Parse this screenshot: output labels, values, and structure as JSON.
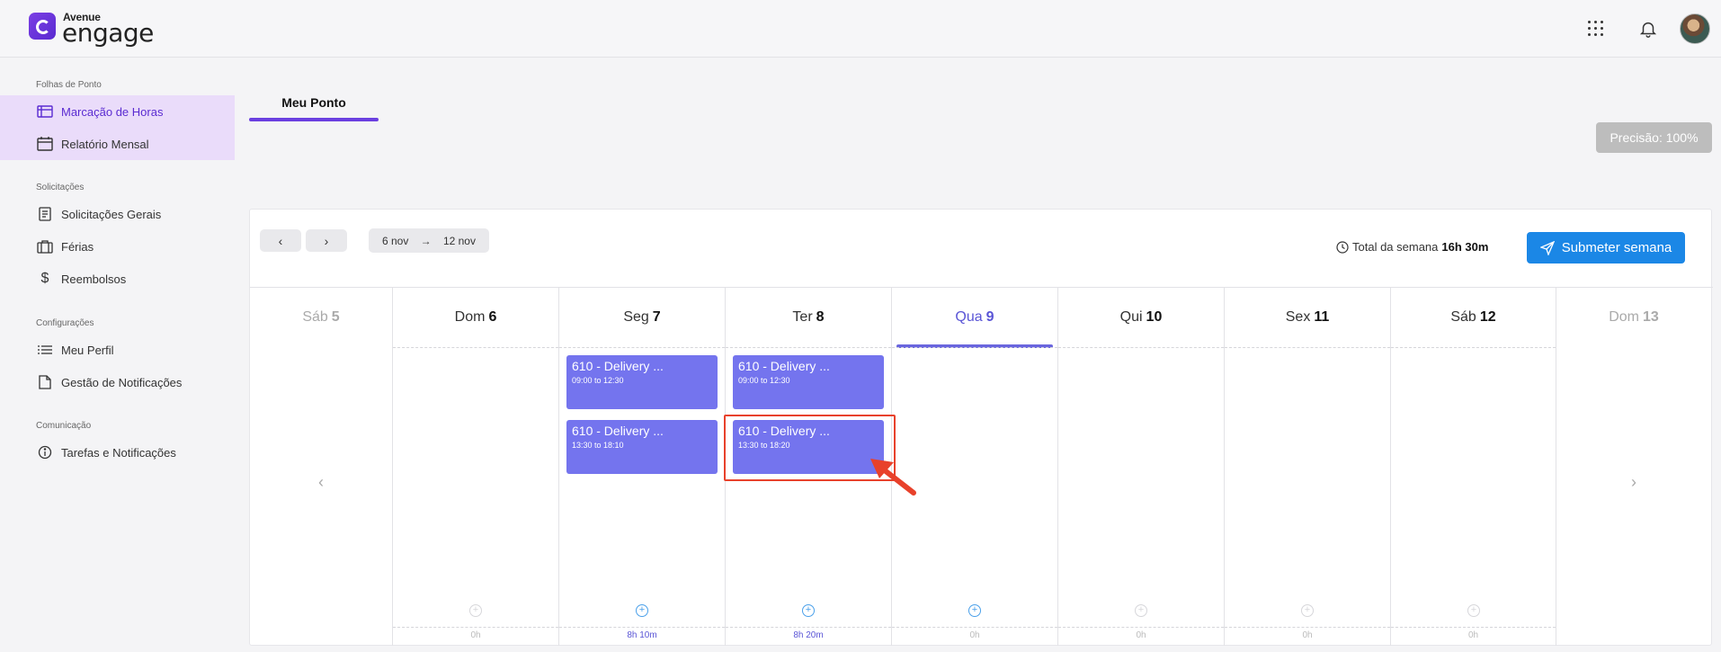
{
  "brand": {
    "top": "Avenue",
    "main": "engage"
  },
  "sidebar": {
    "sections": [
      {
        "title": "Folhas de Ponto"
      },
      {
        "title": "Solicitações"
      },
      {
        "title": "Configurações"
      },
      {
        "title": "Comunicação"
      }
    ],
    "items": [
      {
        "label": "Marcação de Horas",
        "icon": "timesheet-icon"
      },
      {
        "label": "Relatório Mensal",
        "icon": "calendar-icon"
      },
      {
        "label": "Solicitações Gerais",
        "icon": "form-icon"
      },
      {
        "label": "Férias",
        "icon": "suitcase-icon"
      },
      {
        "label": "Reembolsos",
        "icon": "dollar-icon"
      },
      {
        "label": "Meu Perfil",
        "icon": "list-icon"
      },
      {
        "label": "Gestão de Notificações",
        "icon": "document-icon"
      },
      {
        "label": "Tarefas e Notificações",
        "icon": "info-icon"
      }
    ]
  },
  "tabs": {
    "active": "Meu Ponto"
  },
  "precision": "Precisão: 100%",
  "toolbar": {
    "prev": "‹",
    "next": "›",
    "range_start": "6 nov",
    "range_arrow": "→",
    "range_end": "12 nov",
    "week_total_label": "Total da semana",
    "week_total_value": "16h 30m",
    "submit_label": "Submeter semana"
  },
  "days": [
    {
      "name": "Sáb",
      "num": "5"
    },
    {
      "name": "Dom",
      "num": "6",
      "total": "0h"
    },
    {
      "name": "Seg",
      "num": "7",
      "total": "8h 10m"
    },
    {
      "name": "Ter",
      "num": "8",
      "total": "8h 20m"
    },
    {
      "name": "Qua",
      "num": "9",
      "total": "0h"
    },
    {
      "name": "Qui",
      "num": "10",
      "total": "0h"
    },
    {
      "name": "Sex",
      "num": "11",
      "total": "0h"
    },
    {
      "name": "Sáb",
      "num": "12",
      "total": "0h"
    },
    {
      "name": "Dom",
      "num": "13"
    }
  ],
  "entries": {
    "seg_1": {
      "title": "610 - Delivery ...",
      "time": "09:00 to 12:30"
    },
    "seg_2": {
      "title": "610 - Delivery ...",
      "time": "13:30 to 18:10"
    },
    "ter_1": {
      "title": "610 - Delivery ...",
      "time": "09:00 to 12:30"
    },
    "ter_2": {
      "title": "610 - Delivery ...",
      "time": "13:30 to 18:20"
    }
  },
  "colors": {
    "accent": "#6a3fe0",
    "entry": "#7474ee",
    "submit": "#1b87e6",
    "highlight": "#e8412b"
  }
}
